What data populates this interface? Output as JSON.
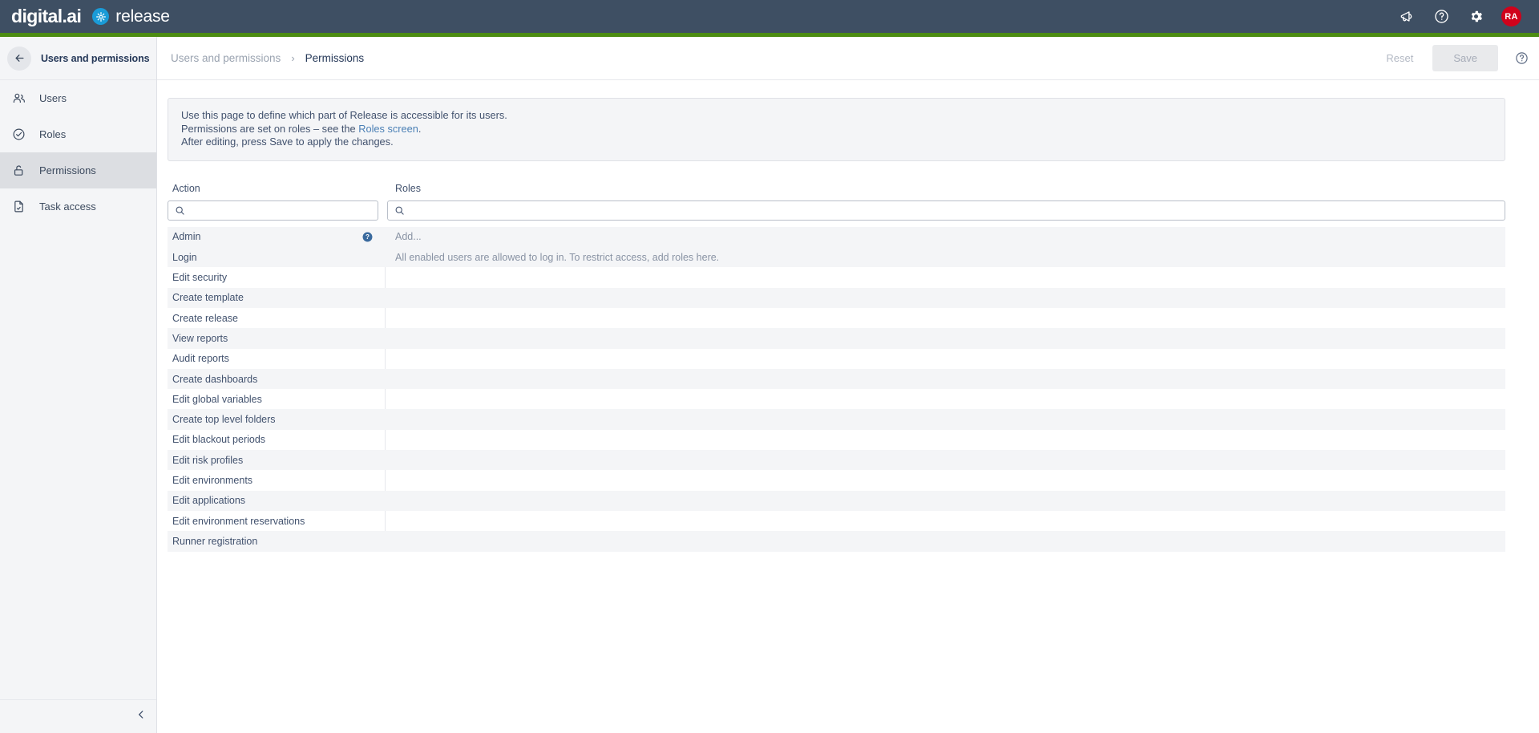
{
  "topbar": {
    "brand_primary": "digital.ai",
    "brand_secondary": "release",
    "icons": [
      {
        "name": "announcements-icon"
      },
      {
        "name": "help-icon"
      },
      {
        "name": "settings-gear-icon"
      }
    ],
    "avatar_initials": "RA",
    "avatar_color": "#d0021b",
    "background_color": "#3e4f63",
    "accent_color": "#4c8c12"
  },
  "sidebar": {
    "title": "Users and permissions",
    "back_icon": "arrow-left-icon",
    "collapse_icon": "chevron-left-icon",
    "items": [
      {
        "label": "Users",
        "icon": "users-icon",
        "active": false
      },
      {
        "label": "Roles",
        "icon": "check-circle-icon",
        "active": false
      },
      {
        "label": "Permissions",
        "icon": "unlock-icon",
        "active": true
      },
      {
        "label": "Task access",
        "icon": "file-check-icon",
        "active": false
      }
    ]
  },
  "header": {
    "breadcrumb_parent": "Users and permissions",
    "breadcrumb_separator": "›",
    "breadcrumb_current": "Permissions",
    "reset_label": "Reset",
    "save_label": "Save",
    "help_icon": "help-circle-icon"
  },
  "info_box": {
    "line1": "Use this page to define which part of Release is accessible for its users.",
    "line2_pre": "Permissions are set on roles – see the ",
    "line2_link": "Roles screen",
    "line2_post": ".",
    "line3": "After editing, press Save to apply the changes."
  },
  "table": {
    "column_action": "Action",
    "column_roles": "Roles",
    "search_action_placeholder": "",
    "search_action_value": "",
    "search_roles_placeholder": "",
    "search_roles_value": "",
    "search_icon": "search-icon",
    "rows": [
      {
        "action": "Admin",
        "roles": "Add...",
        "roles_type": "add",
        "help": true,
        "stripe": true
      },
      {
        "action": "Login",
        "roles": "All enabled users are allowed to log in. To restrict access, add roles here.",
        "roles_type": "text",
        "help": false,
        "stripe": true
      },
      {
        "action": "Edit security",
        "roles": "",
        "roles_type": "empty",
        "help": false,
        "stripe": false
      },
      {
        "action": "Create template",
        "roles": "",
        "roles_type": "empty",
        "help": false,
        "stripe": true
      },
      {
        "action": "Create release",
        "roles": "",
        "roles_type": "empty",
        "help": false,
        "stripe": false
      },
      {
        "action": "View reports",
        "roles": "",
        "roles_type": "empty",
        "help": false,
        "stripe": true
      },
      {
        "action": "Audit reports",
        "roles": "",
        "roles_type": "empty",
        "help": false,
        "stripe": false
      },
      {
        "action": "Create dashboards",
        "roles": "",
        "roles_type": "empty",
        "help": false,
        "stripe": true
      },
      {
        "action": "Edit global variables",
        "roles": "",
        "roles_type": "empty",
        "help": false,
        "stripe": false
      },
      {
        "action": "Create top level folders",
        "roles": "",
        "roles_type": "empty",
        "help": false,
        "stripe": true
      },
      {
        "action": "Edit blackout periods",
        "roles": "",
        "roles_type": "empty",
        "help": false,
        "stripe": false
      },
      {
        "action": "Edit risk profiles",
        "roles": "",
        "roles_type": "empty",
        "help": false,
        "stripe": true
      },
      {
        "action": "Edit environments",
        "roles": "",
        "roles_type": "empty",
        "help": false,
        "stripe": false
      },
      {
        "action": "Edit applications",
        "roles": "",
        "roles_type": "empty",
        "help": false,
        "stripe": true
      },
      {
        "action": "Edit environment reservations",
        "roles": "",
        "roles_type": "empty",
        "help": false,
        "stripe": false
      },
      {
        "action": "Runner registration",
        "roles": "",
        "roles_type": "empty",
        "help": false,
        "stripe": true
      }
    ]
  }
}
